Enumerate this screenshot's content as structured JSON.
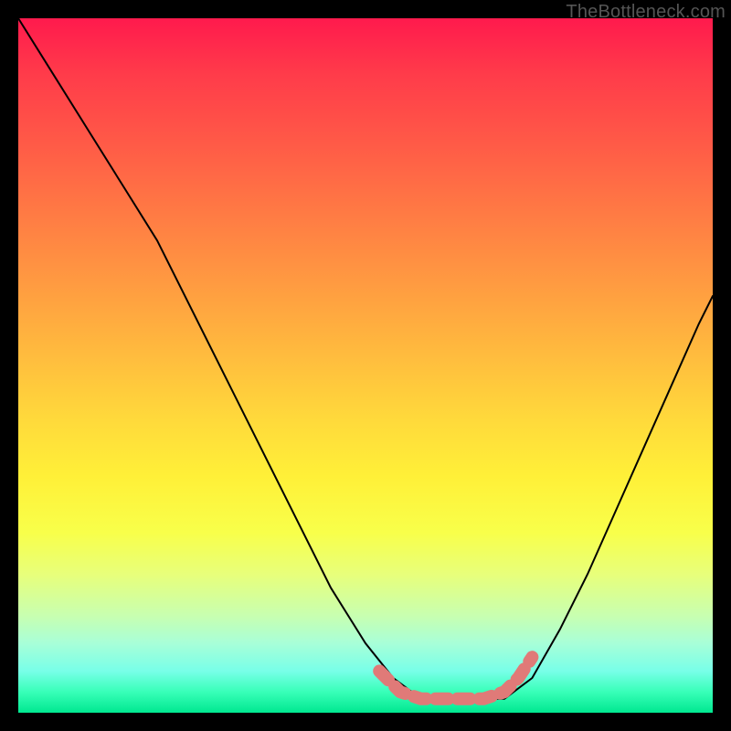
{
  "watermark": "TheBottleneck.com",
  "colors": {
    "curve_stroke": "#000000",
    "highlight_stroke": "#e07a78",
    "background_black": "#000000"
  },
  "chart_data": {
    "type": "line",
    "title": "",
    "xlabel": "",
    "ylabel": "",
    "xlim": [
      0,
      100
    ],
    "ylim": [
      0,
      100
    ],
    "grid": false,
    "series": [
      {
        "name": "curve",
        "x": [
          0,
          5,
          10,
          15,
          20,
          25,
          30,
          35,
          40,
          45,
          50,
          54,
          58,
          62,
          66,
          70,
          74,
          78,
          82,
          86,
          90,
          94,
          98,
          100
        ],
        "y": [
          100,
          92,
          84,
          76,
          68,
          58,
          48,
          38,
          28,
          18,
          10,
          5,
          2,
          2,
          2,
          2,
          5,
          12,
          20,
          29,
          38,
          47,
          56,
          60
        ]
      }
    ],
    "annotations": [
      {
        "name": "valley-highlight",
        "x": [
          52,
          55,
          58,
          61,
          64,
          67,
          70,
          72,
          74
        ],
        "y": [
          6,
          3,
          2,
          2,
          2,
          2,
          3,
          5,
          8
        ]
      }
    ]
  }
}
